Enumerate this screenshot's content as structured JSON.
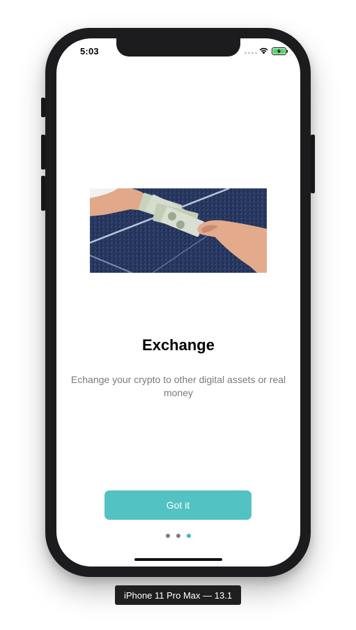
{
  "status_bar": {
    "time": "5:03",
    "icons": [
      "cellular-signal-icon",
      "wifi-icon",
      "battery-charging-icon"
    ]
  },
  "onboarding": {
    "image": "cash-exchange-hands-photo",
    "title": "Exchange",
    "description": "Echange your crypto to other digital assets or real money",
    "button_label": "Got it",
    "page_count": 3,
    "current_page": 3
  },
  "simulator": {
    "device_label": "iPhone 11 Pro Max — 13.1"
  },
  "colors": {
    "accent": "#52c2c3",
    "dot_active": "#3fb6c4",
    "dot_inactive": "#7c7c7c",
    "subtitle": "#7a7a7a",
    "frame": "#1c1c1e"
  }
}
